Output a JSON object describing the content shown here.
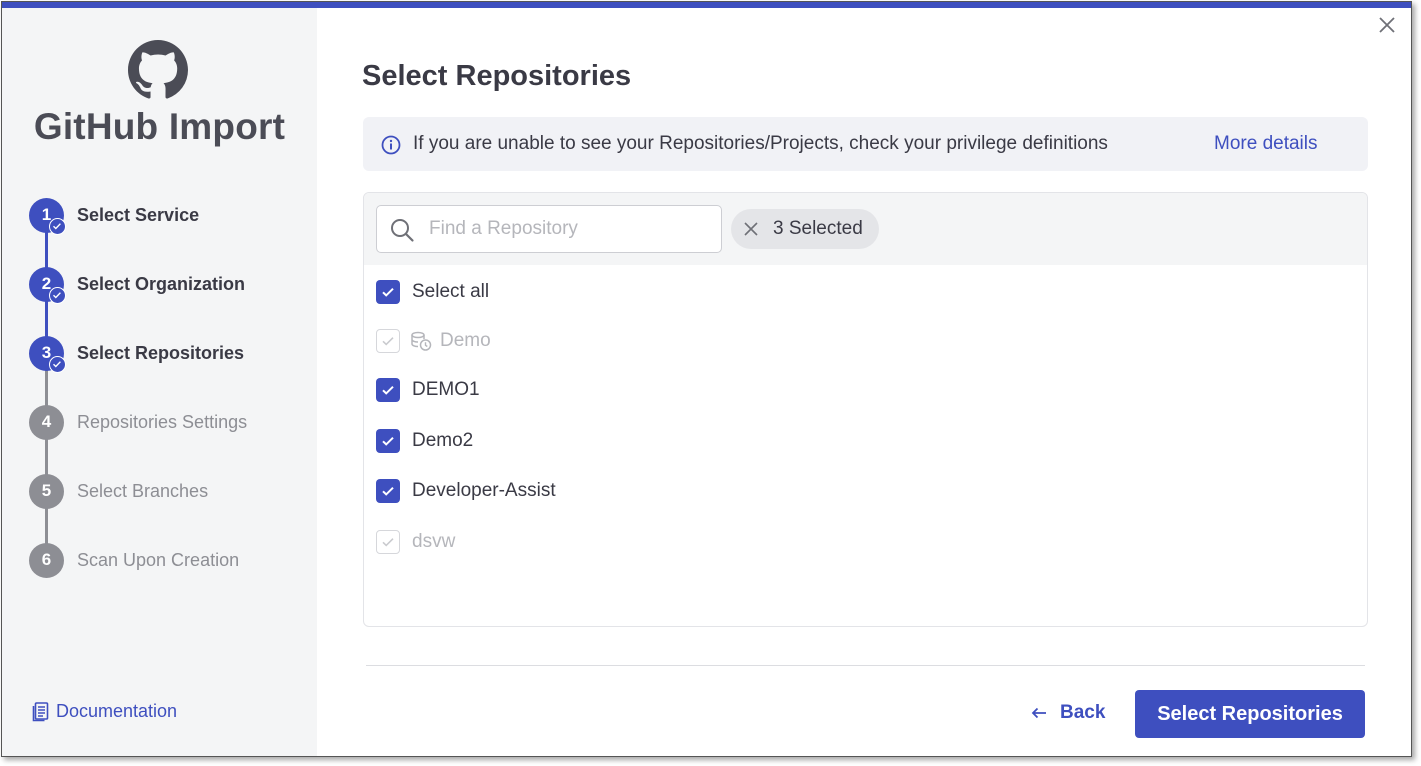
{
  "app": {
    "title": "GitHub Import",
    "logo_icon": "github-icon",
    "accent": "#3e4fbf"
  },
  "steps": [
    {
      "number": "1",
      "label": "Select Service",
      "status": "completed"
    },
    {
      "number": "2",
      "label": "Select Organization",
      "status": "completed"
    },
    {
      "number": "3",
      "label": "Select Repositories",
      "status": "current"
    },
    {
      "number": "4",
      "label": "Repositories Settings",
      "status": "pending"
    },
    {
      "number": "5",
      "label": "Select Branches",
      "status": "pending"
    },
    {
      "number": "6",
      "label": "Scan Upon Creation",
      "status": "pending"
    }
  ],
  "sidebar": {
    "documentation_label": "Documentation",
    "documentation_icon": "document-icon"
  },
  "main": {
    "title": "Select Repositories",
    "info": {
      "text": "If you are unable to see your Repositories/Projects, check your privilege definitions",
      "link": "More details"
    },
    "search": {
      "placeholder": "Find a Repository",
      "value": ""
    },
    "selected_chip": "3 Selected",
    "select_all": {
      "label": "Select all",
      "checked": true
    },
    "repositories": [
      {
        "name": "Demo",
        "checked": true,
        "disabled": true,
        "icon": "database-clock-icon"
      },
      {
        "name": "DEMO1",
        "checked": true,
        "disabled": false
      },
      {
        "name": "Demo2",
        "checked": true,
        "disabled": false
      },
      {
        "name": "Developer-Assist",
        "checked": true,
        "disabled": false
      },
      {
        "name": "dsvw",
        "checked": true,
        "disabled": true
      }
    ]
  },
  "footer": {
    "back_label": "Back",
    "primary_label": "Select Repositories"
  }
}
